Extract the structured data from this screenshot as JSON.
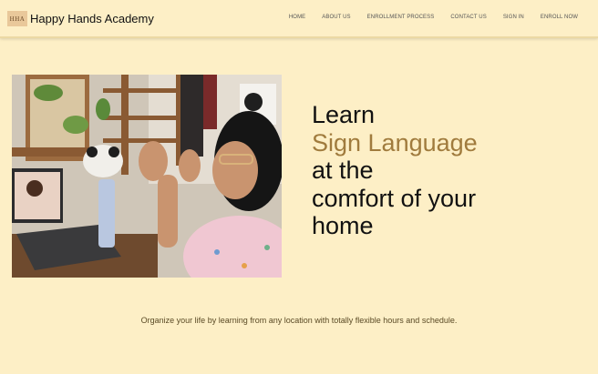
{
  "header": {
    "logo_text": "HHA",
    "brand": "Happy Hands Academy",
    "nav": [
      "HOME",
      "ABOUT US",
      "ENROLLMENT PROCESS",
      "CONTACT US",
      "SIGN IN",
      "ENROLL NOW"
    ]
  },
  "hero": {
    "line1": "Learn",
    "line2": "Sign Language",
    "line3": "at the",
    "line4": "comfort of your",
    "line5": "home"
  },
  "tagline": "Organize your life by learning from any location with totally flexible hours and schedule.",
  "colors": {
    "background": "#fdefc6",
    "accent": "#a07b3d"
  }
}
